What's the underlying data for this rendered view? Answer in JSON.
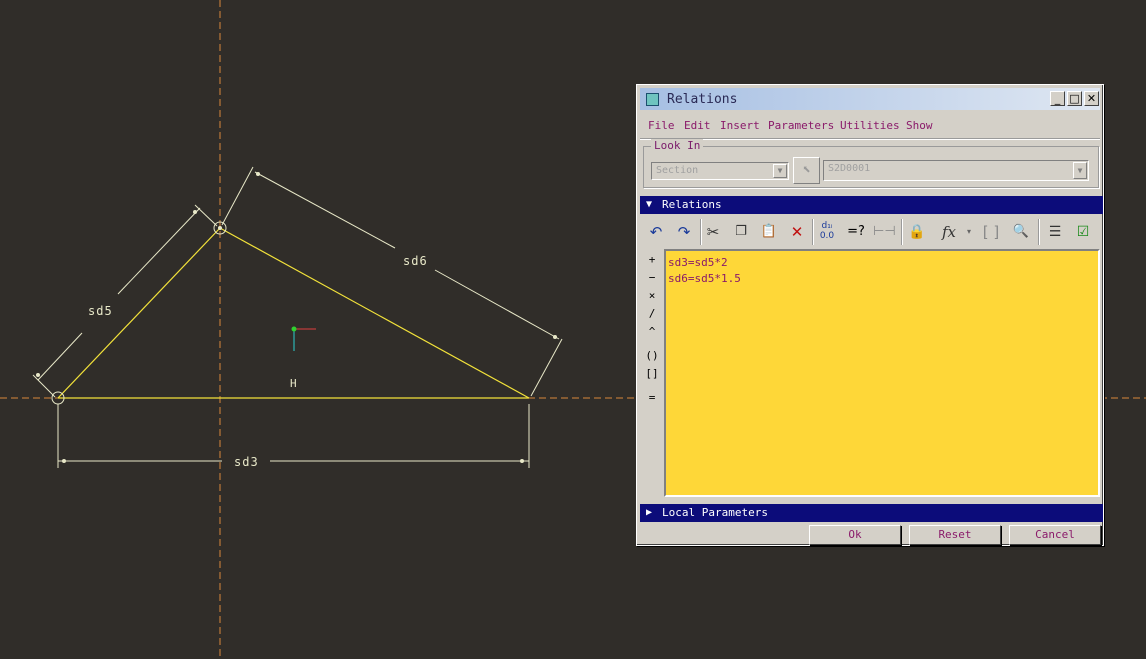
{
  "sketch": {
    "dims": {
      "sd5": "sd5",
      "sd6": "sd6",
      "sd3": "sd3",
      "h": "H"
    },
    "colors": {
      "background": "#302d29",
      "geometry": "#f2e23a",
      "dimension": "#e8e8c8",
      "centerline": "#d8883a"
    }
  },
  "dialog": {
    "title": "Relations",
    "window_buttons": [
      "_",
      "□",
      "✕"
    ],
    "menu": [
      "File",
      "Edit",
      "Insert",
      "Parameters",
      "Utilities",
      "Show"
    ],
    "look_in": {
      "label": "Look In",
      "type_value": "Section",
      "name_value": "S2D0001"
    },
    "relations_section": "Relations",
    "toolbar_icons": [
      "undo-icon",
      "redo-icon",
      "cut-icon",
      "copy-icon",
      "paste-icon",
      "delete-icon",
      "switch-dims-icon",
      "evaluate-icon",
      "display-dims-icon",
      "lock-icon",
      "function-icon",
      "parameter-icon",
      "verify-icon",
      "sort-icon",
      "check-icon"
    ],
    "evaluate_label": "=?",
    "function_label": "fx",
    "operators": [
      "+",
      "−",
      "×",
      "/",
      "^",
      "()",
      "[]",
      "="
    ],
    "relations_text": [
      "sd3=sd5*2",
      "sd6=sd5*1.5"
    ],
    "local_params_section": "Local Parameters",
    "buttons": {
      "ok": "Ok",
      "reset": "Reset",
      "cancel": "Cancel"
    },
    "colors": {
      "editor_bg": "#fed738",
      "section_bar": "#0c0c7a",
      "text": "#8a1a6a"
    }
  }
}
